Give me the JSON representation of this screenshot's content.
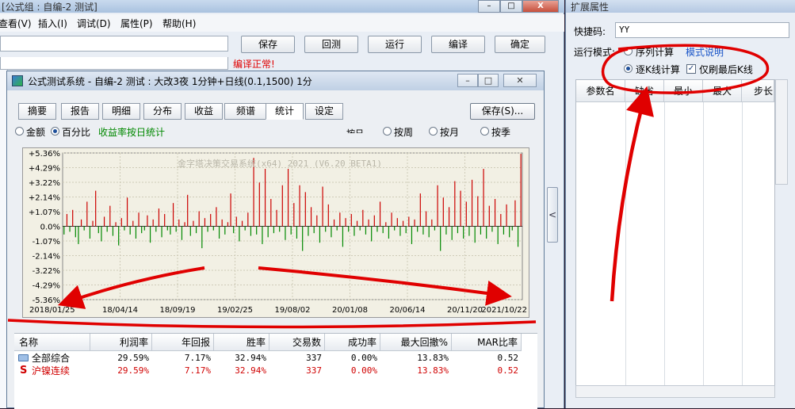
{
  "editor": {
    "title": "[公式组 : 自编-2 测试]",
    "menu": [
      "查看(V)",
      "插入(I)",
      "调试(D)",
      "属性(P)",
      "帮助(H)"
    ],
    "buttons": {
      "save": "保存",
      "backtest": "回测",
      "run": "运行",
      "compile": "编译",
      "ok": "确定"
    },
    "compile_status": "编译正常!",
    "close_glyph": "X"
  },
  "dialog": {
    "title": "公式测试系统 - 自编-2 测试 : 大改3夜 1分钟+日线(0.1,1500) 1分",
    "tabs": [
      "摘要",
      "报告",
      "明细",
      "分布",
      "收益",
      "频谱",
      "统计",
      "设定"
    ],
    "active_tab": "统计",
    "save_button": "保存(S)...",
    "options": {
      "amount": "金额",
      "percent": "百分比",
      "daily_note": "收益率按日统计",
      "byday_partial": "按日",
      "byweek": "按周",
      "bymonth": "按月",
      "byquarter": "按季"
    },
    "watermark": "金字塔决策交易系统(x64) 2021 (V6.20 BETA1)"
  },
  "chart_data": {
    "type": "bar",
    "ylim": [
      -5.36,
      5.36
    ],
    "y_ticks": [
      "+5.36%",
      "+4.29%",
      "+3.22%",
      "+2.14%",
      "+1.07%",
      "0.0%",
      "-1.07%",
      "-2.14%",
      "-3.22%",
      "-4.29%",
      "-5.36%"
    ],
    "x_ticks": [
      "2018/01/25",
      "18/04/14",
      "18/09/19",
      "19/02/25",
      "19/08/02",
      "20/01/08",
      "20/06/14",
      "20/11/20",
      "2021/10/22"
    ],
    "positive_color": "#cc0000",
    "negative_color": "#008800",
    "values": [
      -0.6,
      0.9,
      -0.4,
      1.2,
      -0.8,
      -1.3,
      0.5,
      -0.3,
      1.8,
      -0.9,
      0.4,
      2.6,
      -0.5,
      -1.1,
      0.7,
      -0.4,
      1.5,
      -0.7,
      0.3,
      -1.4,
      0.6,
      -0.3,
      2.1,
      -0.6,
      0.4,
      -0.9,
      1.0,
      -0.5,
      -0.3,
      0.8,
      -1.2,
      0.5,
      -0.4,
      1.3,
      -0.8,
      0.9,
      -0.3,
      -0.6,
      1.7,
      -0.4,
      0.5,
      -1.0,
      0.3,
      2.3,
      -0.7,
      0.4,
      -0.5,
      1.1,
      -1.6,
      0.6,
      -0.4,
      0.9,
      -0.3,
      1.4,
      -0.9,
      0.5,
      -0.6,
      0.3,
      2.4,
      -0.5,
      0.7,
      -1.1,
      0.4,
      -0.3,
      1.0,
      -0.7,
      5.0,
      -0.6,
      3.2,
      -1.3,
      4.2,
      -0.8,
      2.0,
      -0.5,
      1.2,
      -0.4,
      3.0,
      -1.0,
      4.2,
      -0.6,
      1.7,
      -0.9,
      3.0,
      -1.8,
      2.5,
      -0.7,
      1.4,
      -0.5,
      0.8,
      -1.2,
      2.9,
      -0.4,
      1.6,
      -0.8,
      0.5,
      -0.3,
      1.0,
      -1.5,
      0.6,
      -0.4,
      0.9,
      -0.7,
      0.4,
      -0.3,
      1.2,
      -0.6,
      0.5,
      -1.1,
      0.8,
      -0.4,
      1.8,
      -0.5,
      0.3,
      -0.9,
      1.0,
      -0.3,
      0.6,
      -0.7,
      0.4,
      -0.5,
      0.7,
      -1.3,
      0.5,
      -0.4,
      2.4,
      -0.6,
      1.1,
      -0.8,
      0.5,
      -0.3,
      3.0,
      -1.8,
      2.1,
      -0.6,
      1.4,
      -1.0,
      3.3,
      -0.5,
      2.6,
      -0.9,
      1.8,
      -0.7,
      3.4,
      -1.2,
      2.2,
      -0.6,
      4.2,
      -0.9,
      1.5,
      -0.4,
      2.0,
      -1.3,
      0.9,
      -0.6,
      1.6,
      -0.8,
      -0.3,
      1.9,
      -1.5,
      5.3
    ]
  },
  "table": {
    "headers": [
      "名称",
      "利润率",
      "年回报",
      "胜率",
      "交易数",
      "成功率",
      "最大回撤%",
      "MAR比率"
    ],
    "rows": [
      {
        "icon": "folder-icon",
        "name": "全部综合",
        "cells": [
          "29.59%",
          "7.17%",
          "32.94%",
          "337",
          "0.00%",
          "13.83%",
          "0.52"
        ]
      },
      {
        "icon": "S",
        "name": "沪镍连续",
        "cells": [
          "29.59%",
          "7.17%",
          "32.94%",
          "337",
          "0.00%",
          "13.83%",
          "0.52"
        ]
      }
    ]
  },
  "panel": {
    "title": "扩展属性",
    "shortcut_label": "快捷码:",
    "shortcut_value": "YY",
    "mode_label": "运行模式:",
    "mode_serial": "序列计算",
    "mode_help": "模式说明",
    "mode_tick": "逐K线计算",
    "refresh_last": "仅刷最后K线",
    "param_headers": [
      "参数名",
      "缺省",
      "最小",
      "最大",
      "步长"
    ]
  },
  "splitter_glyph": "<"
}
